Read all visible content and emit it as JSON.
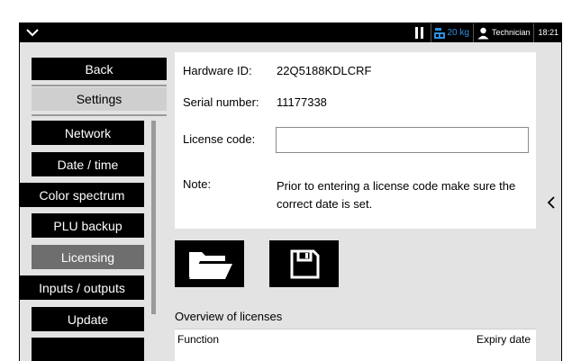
{
  "status_bar": {
    "max_weight": "20 kg",
    "user_name": "Technician",
    "time": "18:21"
  },
  "nav": {
    "back_label": "Back",
    "settings_label": "Settings",
    "items": [
      {
        "label": "Network"
      },
      {
        "label": "Date / time"
      },
      {
        "label": "Color spectrum"
      },
      {
        "label": "PLU backup"
      },
      {
        "label": "Licensing",
        "active": true
      },
      {
        "label": "Inputs / outputs"
      },
      {
        "label": "Update"
      }
    ]
  },
  "license_info": {
    "hardware_id_label": "Hardware ID:",
    "hardware_id_value": "22Q5188KDLCRF",
    "serial_label": "Serial number:",
    "serial_value": "11177338",
    "license_code_label": "License code:",
    "license_code_value": "",
    "note_label": "Note:",
    "note_text": "Prior to entering a license code make sure the correct date is set."
  },
  "overview": {
    "title": "Overview of licenses",
    "columns": [
      "Function",
      "Expiry date"
    ]
  },
  "icons": {
    "open": "folder-open-icon",
    "save": "floppy-disk-icon",
    "user": "user-icon",
    "weight": "scale-icon"
  },
  "colors": {
    "accent_blue": "#2d8fe0",
    "active_item": "#6e6e6e"
  }
}
